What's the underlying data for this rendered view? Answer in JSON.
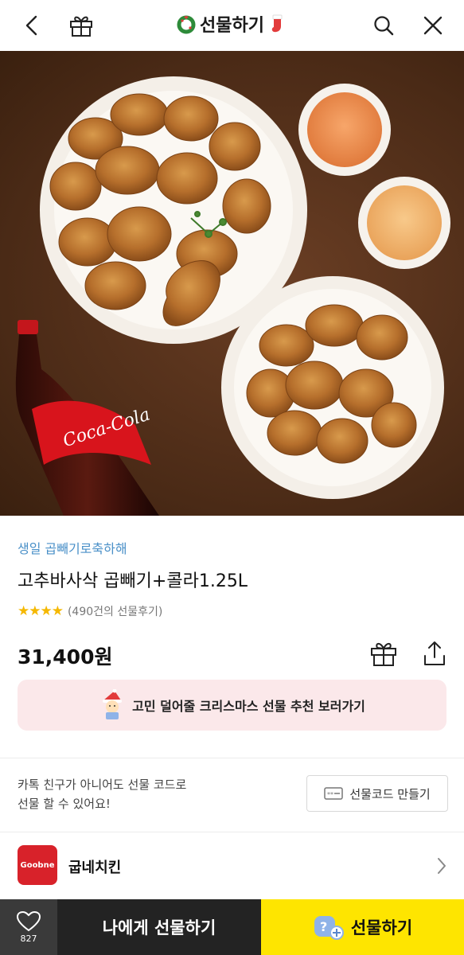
{
  "header": {
    "title": "선물하기",
    "icons": [
      "back-icon",
      "gift-icon",
      "wreath-icon",
      "stocking-icon",
      "search-icon",
      "close-icon"
    ]
  },
  "product": {
    "brand_tag": "생일 곱빼기로축하해",
    "name": "고추바사삭 곱빼기+콜라1.25L",
    "stars": "★★★★",
    "review_count": "(490건의 선물후기)",
    "price": "31,400원",
    "bottle_label": "Coca-Cola"
  },
  "promo": {
    "text": "고민 덜어줄 크리스마스 선물 추천 보러가기"
  },
  "gift_code": {
    "description_line1": "카톡 친구가 아니어도 선물 코드로",
    "description_line2": "선물 할 수 있어요!",
    "button_label": "선물코드 만들기"
  },
  "brand": {
    "logo_text": "Goobne",
    "name": "굽네치킨"
  },
  "bottom_bar": {
    "wish_count": "827",
    "self_gift_label": "나에게 선물하기",
    "send_gift_label": "선물하기"
  },
  "colors": {
    "accent_yellow": "#fee500",
    "dark_bar": "#232323",
    "wish_bg": "#3a3a3a",
    "brand_tag_blue": "#4a90c8",
    "star_yellow": "#f5b800",
    "promo_bg": "#fbe8ea",
    "goobne_red": "#d8222a"
  }
}
